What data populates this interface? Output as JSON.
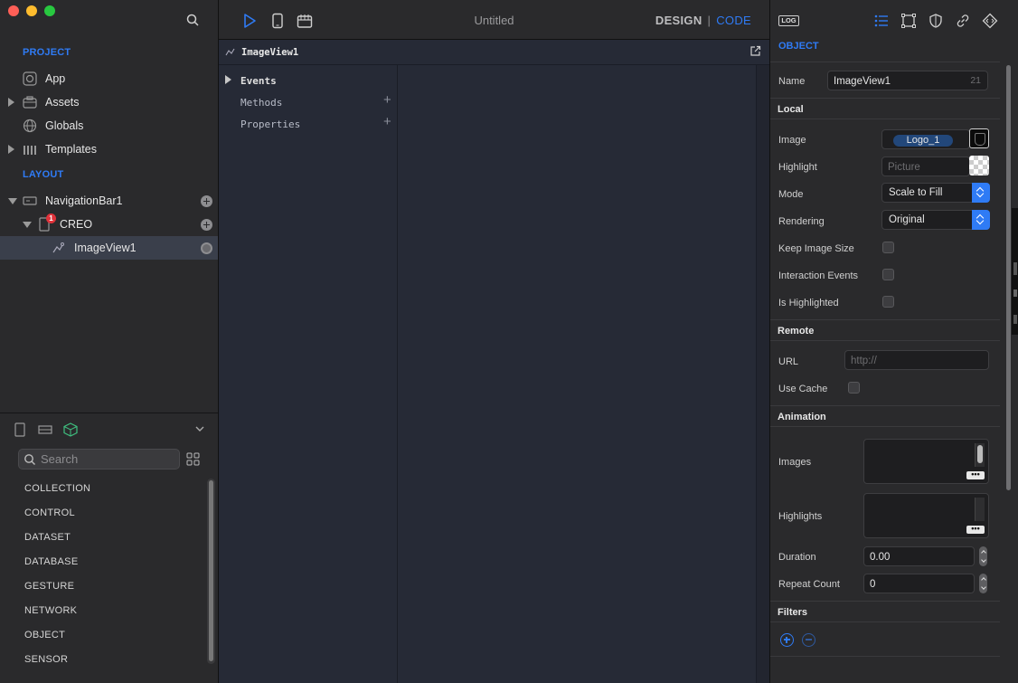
{
  "sidebar": {
    "project_title": "PROJECT",
    "project_items": [
      "App",
      "Assets",
      "Globals",
      "Templates"
    ],
    "layout_title": "LAYOUT",
    "layout_items": [
      "NavigationBar1",
      "CREO",
      "ImageView1"
    ],
    "badge": "1"
  },
  "library": {
    "search_placeholder": "Search",
    "categories": [
      "COLLECTION",
      "CONTROL",
      "DATASET",
      "DATABASE",
      "GESTURE",
      "NETWORK",
      "OBJECT",
      "SENSOR"
    ]
  },
  "toolbar": {
    "title": "Untitled",
    "design": "DESIGN",
    "separator": "|",
    "code": "CODE"
  },
  "code": {
    "object_name": "ImageView1",
    "outline": [
      "Events",
      "Methods",
      "Properties"
    ],
    "plus": "+"
  },
  "inspector": {
    "log": "LOG",
    "section_title": "OBJECT",
    "name_label": "Name",
    "name_value": "ImageView1",
    "name_count": "21",
    "local_title": "Local",
    "image_label": "Image",
    "image_value": "Logo_1",
    "highlight_label": "Highlight",
    "highlight_placeholder": "Picture",
    "mode_label": "Mode",
    "mode_value": "Scale to Fill",
    "rendering_label": "Rendering",
    "rendering_value": "Original",
    "keep_size_label": "Keep Image Size",
    "interaction_label": "Interaction Events",
    "highlighted_label": "Is Highlighted",
    "remote_title": "Remote",
    "url_label": "URL",
    "url_placeholder": "http://",
    "cache_label": "Use Cache",
    "animation_title": "Animation",
    "images_label": "Images",
    "highlights_label": "Highlights",
    "duration_label": "Duration",
    "duration_value": "0.00",
    "repeat_label": "Repeat Count",
    "repeat_value": "0",
    "filters_title": "Filters",
    "dots": "•••"
  },
  "colors": {
    "accent": "#2f7bf5",
    "badge": "#e0323a"
  }
}
